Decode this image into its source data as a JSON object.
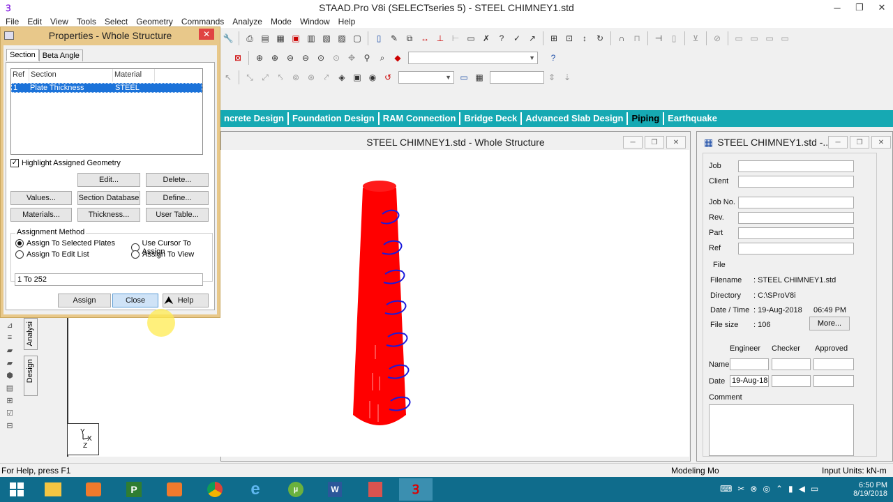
{
  "window": {
    "title": "STAAD.Pro V8i (SELECTseries 5) - STEEL CHIMNEY1.std",
    "minimize": "─",
    "restore": "❐",
    "close": "✕"
  },
  "menu": [
    "File",
    "Edit",
    "View",
    "Tools",
    "Select",
    "Geometry",
    "Commands",
    "Analyze",
    "Mode",
    "Window",
    "Help"
  ],
  "page_tabs": {
    "items": [
      "ncrete Design",
      "Foundation Design",
      "RAM Connection",
      "Bridge Deck",
      "Advanced Slab Design",
      "Piping",
      "Earthquake"
    ],
    "active": "Piping"
  },
  "view_window": {
    "title": "STEEL CHIMNEY1.std - Whole Structure",
    "axis_y": "Y",
    "axis_x": "X",
    "axis_z": "Z"
  },
  "info_window": {
    "title": "STEEL CHIMNEY1.std -...",
    "fields": {
      "job_label": "Job",
      "client_label": "Client",
      "job_no_label": "Job No.",
      "rev_label": "Rev.",
      "part_label": "Part",
      "ref_label": "Ref"
    },
    "file_group": "File",
    "filename_label": "Filename",
    "filename_value": ": STEEL CHIMNEY1.std",
    "directory_label": "Directory",
    "directory_value": ": C:\\SProV8i",
    "datetime_label": "Date / Time",
    "date_value": ": 19-Aug-2018",
    "time_value": "06:49 PM",
    "filesize_label": "File size",
    "filesize_value": ": 106",
    "more_button": "More...",
    "engineer_label": "Engineer",
    "checker_label": "Checker",
    "approved_label": "Approved",
    "name_label": "Name",
    "date_label": "Date",
    "date_input": "19-Aug-18",
    "comment_label": "Comment"
  },
  "properties_dialog": {
    "title": "Properties - Whole Structure",
    "tabs": [
      "Section",
      "Beta Angle"
    ],
    "columns": [
      "Ref",
      "Section",
      "Material"
    ],
    "row": {
      "ref": "1",
      "section": "Plate Thickness",
      "material": "STEEL"
    },
    "highlight_checkbox": "Highlight Assigned Geometry",
    "buttons": {
      "edit": "Edit...",
      "delete": "Delete...",
      "values": "Values...",
      "section_database": "Section Database",
      "define": "Define...",
      "materials": "Materials...",
      "thickness": "Thickness...",
      "user_table": "User Table...",
      "assign": "Assign",
      "close": "Close",
      "help": "Help"
    },
    "assignment_method": "Assignment Method",
    "radio": {
      "selected_plates": "Assign To Selected Plates",
      "cursor": "Use Cursor To Assign",
      "edit_list": "Assign To Edit List",
      "view": "Assign To View"
    },
    "list_value": "1 To 252"
  },
  "left_tabs": {
    "analysis": "Analysi",
    "design": "Design"
  },
  "status": {
    "help": "For Help, press F1",
    "mode": "Modeling Mo",
    "units": "Input Units:  kN-m"
  },
  "taskbar": {
    "time": "6:50 PM",
    "date": "8/19/2018"
  },
  "colors": {
    "accent_tabs": "#16a9b3",
    "chimney": "#ff0000",
    "supports": "#1a1adc",
    "taskbar": "#0f6c8c"
  }
}
